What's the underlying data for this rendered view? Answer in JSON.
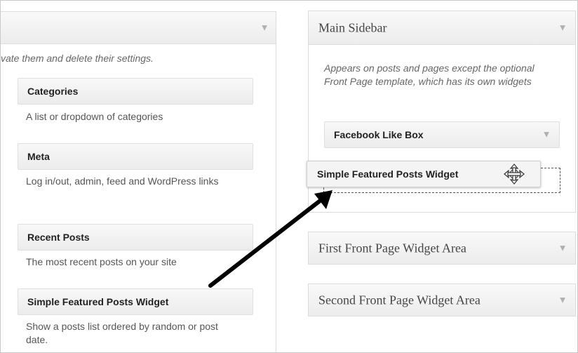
{
  "available": {
    "description": "vate them and delete their settings.",
    "widgets": [
      {
        "title": "Categories",
        "desc": "A list or dropdown of categories"
      },
      {
        "title": "Meta",
        "desc": "Log in/out, admin, feed and WordPress links"
      },
      {
        "title": "Recent Posts",
        "desc": "The most recent posts on your site"
      },
      {
        "title": "Simple Featured Posts Widget",
        "desc": "Show a posts list ordered by random or post date."
      }
    ]
  },
  "sidebar": {
    "title": "Main Sidebar",
    "description": "Appears on posts and pages except the optional Front Page template, which has its own widgets",
    "widgets": [
      {
        "title": "Facebook Like Box"
      }
    ]
  },
  "dragging": {
    "title": "Simple Featured Posts Widget"
  },
  "areas": [
    {
      "title": "First Front Page Widget Area"
    },
    {
      "title": "Second Front Page Widget Area"
    }
  ],
  "icons": {
    "chevron": "chevron-down-icon",
    "move": "move-cursor-icon",
    "arrow": "annotation-arrow-icon"
  }
}
